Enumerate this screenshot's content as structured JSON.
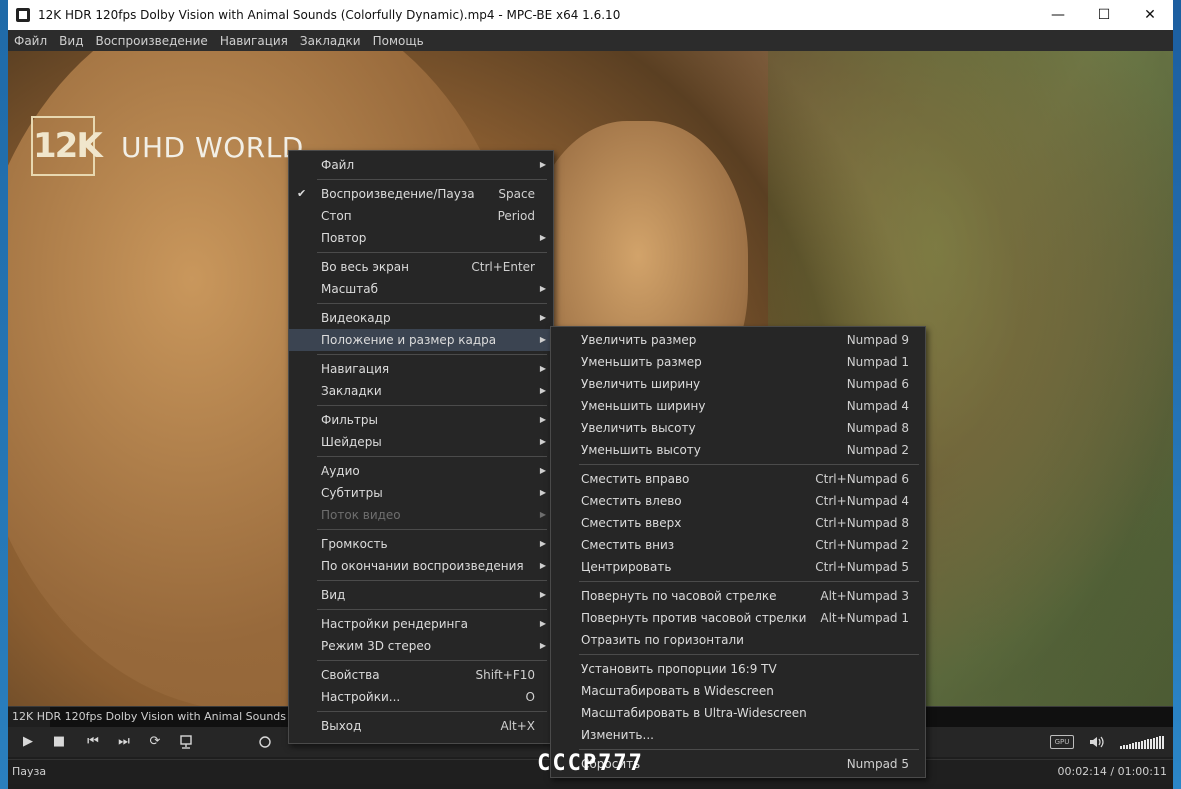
{
  "window": {
    "title": "12K HDR 120fps Dolby Vision with Animal Sounds (Colorfully Dynamic).mp4 - MPC-BE x64 1.6.10",
    "minimize": "—",
    "maximize": "☐",
    "close": "✕"
  },
  "menubar": [
    "Файл",
    "Вид",
    "Воспроизведение",
    "Навигация",
    "Закладки",
    "Помощь"
  ],
  "video": {
    "logo_mark": "12K",
    "logo_text": "UHD WORLD",
    "stamp": "CCCP777"
  },
  "seekbar": {
    "title": "12K HDR  120fps Dolby Vision with Animal Sounds (Colorfu",
    "progress_fraction": 0.036
  },
  "controls": {
    "play": "▶",
    "stop": "■",
    "prev": "⏮",
    "next": "⏭",
    "loop": "⟳",
    "gpu": "GPU",
    "volume_icon": "speaker-icon",
    "volume_level": 1.0
  },
  "status": {
    "state": "Пауза",
    "time": "00:02:14 / 01:00:11"
  },
  "context_menu": {
    "groups": [
      [
        {
          "label": "Файл",
          "submenu": true
        }
      ],
      [
        {
          "label": "Воспроизведение/Пауза",
          "shortcut": "Space",
          "checked": true
        },
        {
          "label": "Стоп",
          "shortcut": "Period"
        },
        {
          "label": "Повтор",
          "submenu": true
        }
      ],
      [
        {
          "label": "Во весь экран",
          "shortcut": "Ctrl+Enter"
        },
        {
          "label": "Масштаб",
          "submenu": true
        }
      ],
      [
        {
          "label": "Видеокадр",
          "submenu": true
        },
        {
          "label": "Положение и размер кадра",
          "submenu": true,
          "highlighted": true
        }
      ],
      [
        {
          "label": "Навигация",
          "submenu": true
        },
        {
          "label": "Закладки",
          "submenu": true
        }
      ],
      [
        {
          "label": "Фильтры",
          "submenu": true
        },
        {
          "label": "Шейдеры",
          "submenu": true
        }
      ],
      [
        {
          "label": "Аудио",
          "submenu": true
        },
        {
          "label": "Субтитры",
          "submenu": true
        },
        {
          "label": "Поток видео",
          "submenu": true,
          "disabled": true
        }
      ],
      [
        {
          "label": "Громкость",
          "submenu": true
        },
        {
          "label": "По окончании воспроизведения",
          "submenu": true
        }
      ],
      [
        {
          "label": "Вид",
          "submenu": true
        }
      ],
      [
        {
          "label": "Настройки рендеринга",
          "submenu": true
        },
        {
          "label": "Режим 3D стерео",
          "submenu": true
        }
      ],
      [
        {
          "label": "Свойства",
          "shortcut": "Shift+F10"
        },
        {
          "label": "Настройки...",
          "shortcut": "O"
        }
      ],
      [
        {
          "label": "Выход",
          "shortcut": "Alt+X"
        }
      ]
    ]
  },
  "submenu": {
    "groups": [
      [
        {
          "label": "Увеличить размер",
          "shortcut": "Numpad 9"
        },
        {
          "label": "Уменьшить размер",
          "shortcut": "Numpad 1"
        },
        {
          "label": "Увеличить ширину",
          "shortcut": "Numpad 6"
        },
        {
          "label": "Уменьшить ширину",
          "shortcut": "Numpad 4"
        },
        {
          "label": "Увеличить высоту",
          "shortcut": "Numpad 8"
        },
        {
          "label": "Уменьшить высоту",
          "shortcut": "Numpad 2"
        }
      ],
      [
        {
          "label": "Сместить вправо",
          "shortcut": "Ctrl+Numpad 6"
        },
        {
          "label": "Сместить влево",
          "shortcut": "Ctrl+Numpad 4"
        },
        {
          "label": "Сместить вверх",
          "shortcut": "Ctrl+Numpad 8"
        },
        {
          "label": "Сместить вниз",
          "shortcut": "Ctrl+Numpad 2"
        },
        {
          "label": "Центрировать",
          "shortcut": "Ctrl+Numpad 5"
        }
      ],
      [
        {
          "label": "Повернуть по часовой стрелке",
          "shortcut": "Alt+Numpad 3"
        },
        {
          "label": "Повернуть против часовой стрелки",
          "shortcut": "Alt+Numpad 1"
        },
        {
          "label": "Отразить по горизонтали",
          "shortcut": ""
        }
      ],
      [
        {
          "label": "Установить пропорции 16:9 TV",
          "shortcut": ""
        },
        {
          "label": "Масштабировать в Widescreen",
          "shortcut": ""
        },
        {
          "label": "Масштабировать в Ultra-Widescreen",
          "shortcut": ""
        },
        {
          "label": "Изменить...",
          "shortcut": ""
        }
      ],
      [
        {
          "label": "Сбросить",
          "shortcut": "Numpad 5"
        }
      ]
    ]
  }
}
